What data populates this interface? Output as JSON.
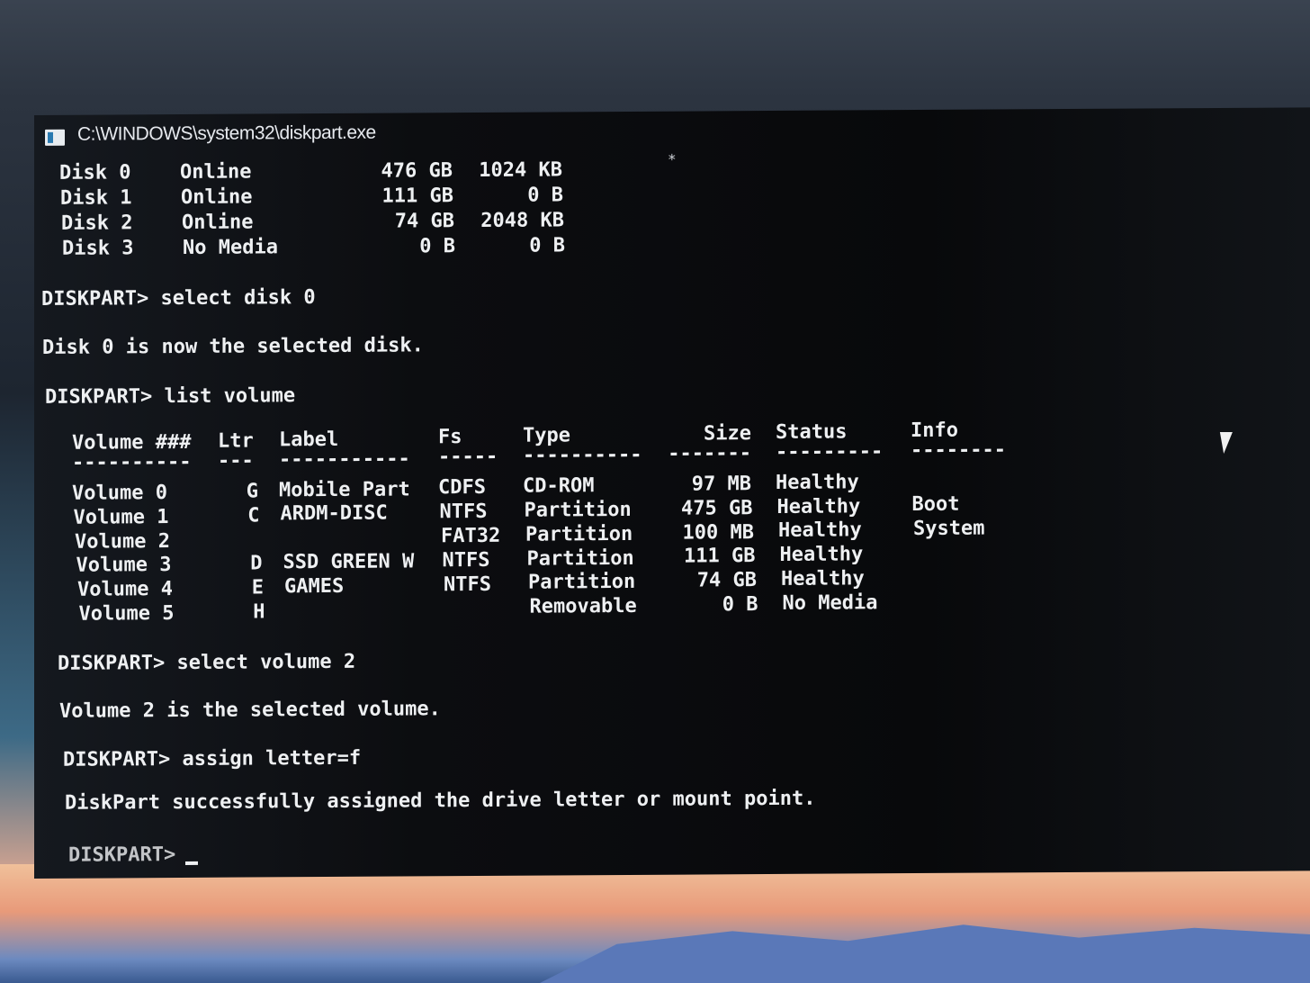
{
  "window": {
    "title": "C:\\WINDOWS\\system32\\diskpart.exe"
  },
  "disks": [
    {
      "name": "Disk 0",
      "status": "Online",
      "size": "476 GB",
      "free": "1024 KB",
      "dyn": "*"
    },
    {
      "name": "Disk 1",
      "status": "Online",
      "size": "111 GB",
      "free": "0 B"
    },
    {
      "name": "Disk 2",
      "status": "Online",
      "size": "74 GB",
      "free": "2048 KB"
    },
    {
      "name": "Disk 3",
      "status": "No Media",
      "size": "0 B",
      "free": "0 B"
    }
  ],
  "lines": {
    "cmd_select_disk": "DISKPART> select disk 0",
    "msg_disk_selected": "Disk 0 is now the selected disk.",
    "cmd_list_volume": "DISKPART> list volume",
    "cmd_select_volume": "DISKPART> select volume 2",
    "msg_volume_selected": "Volume 2 is the selected volume.",
    "cmd_assign": "DISKPART> assign letter=f",
    "msg_assigned": "DiskPart successfully assigned the drive letter or mount point.",
    "prompt": "DISKPART> "
  },
  "volume_table": {
    "headers": [
      "Volume ###",
      "Ltr",
      "Label",
      "Fs",
      "Type",
      "Size",
      "Status",
      "Info"
    ],
    "separators": [
      "----------",
      "---",
      "-----------",
      "-----",
      "----------",
      "-------",
      "---------",
      "--------"
    ],
    "rows": [
      [
        "Volume 0",
        "G",
        "Mobile Part",
        "CDFS",
        "CD-ROM",
        "97 MB",
        "Healthy",
        ""
      ],
      [
        "Volume 1",
        "C",
        "ARDM-DISC",
        "NTFS",
        "Partition",
        "475 GB",
        "Healthy",
        "Boot"
      ],
      [
        "Volume 2",
        "",
        "",
        "FAT32",
        "Partition",
        "100 MB",
        "Healthy",
        "System"
      ],
      [
        "Volume 3",
        "D",
        "SSD GREEN W",
        "NTFS",
        "Partition",
        "111 GB",
        "Healthy",
        ""
      ],
      [
        "Volume 4",
        "E",
        "GAMES",
        "NTFS",
        "Partition",
        "74 GB",
        "Healthy",
        ""
      ],
      [
        "Volume 5",
        "H",
        "",
        "",
        "Removable",
        "0 B",
        "No Media",
        ""
      ]
    ]
  }
}
